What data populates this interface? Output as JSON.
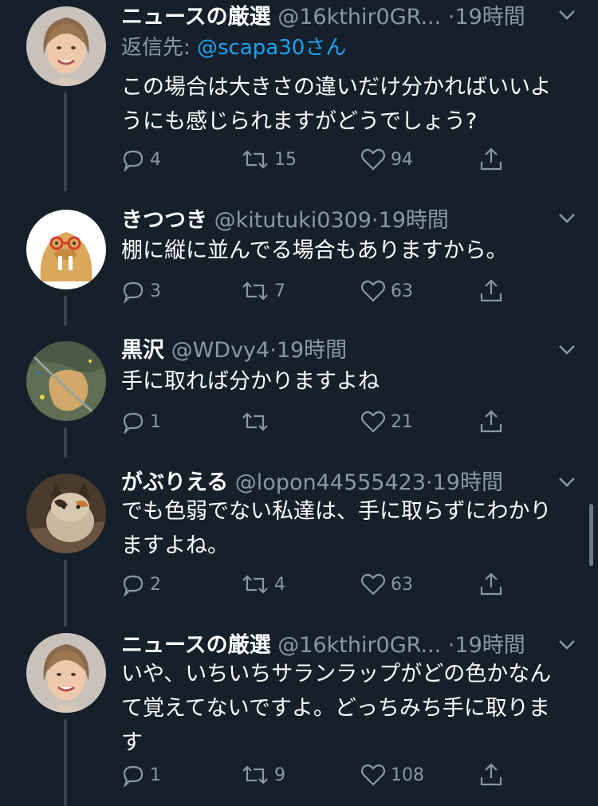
{
  "tweets": [
    {
      "name": "ニュースの厳選",
      "handle": "@16kthir0GR...",
      "time": "19時間",
      "reply_to_label": "返信先:",
      "reply_to_user": "@scapa30さん",
      "text_lines": [
        "この場合は大きさの違いだけ分かればいいよ",
        "うにも感じられますがどうでしょう?"
      ],
      "reply_count": "4",
      "retweet_count": "15",
      "like_count": "94",
      "avatar": "woman-avatar"
    },
    {
      "name": "きつつき",
      "handle": "@kitutuki0309",
      "time": "19時間",
      "text_lines": [
        "棚に縦に並んでる場合もありますから。"
      ],
      "reply_count": "3",
      "retweet_count": "7",
      "like_count": "63",
      "avatar": "walrus-avatar"
    },
    {
      "name": "黒沢",
      "handle": "@WDvy4",
      "time": "19時間",
      "text_lines": [
        "手に取れば分かりますよね"
      ],
      "reply_count": "1",
      "retweet_count": "",
      "like_count": "21",
      "avatar": "map-avatar"
    },
    {
      "name": "がぶりえる",
      "handle": "@lopon44555423",
      "time": "19時間",
      "text_lines": [
        "でも色弱でない私達は、手に取らずにわかり",
        "ますよね。"
      ],
      "reply_count": "2",
      "retweet_count": "4",
      "like_count": "63",
      "avatar": "cat-avatar"
    },
    {
      "name": "ニュースの厳選",
      "handle": "@16kthir0GR...",
      "time": "19時間",
      "text_lines": [
        "いや、いちいちサランラップがどの色かなん",
        "て覚えてないですよ。どっちみち手に取りま",
        "す"
      ],
      "reply_count": "1",
      "retweet_count": "9",
      "like_count": "108",
      "avatar": "woman-avatar"
    }
  ],
  "dot": "·",
  "colors": {
    "background": "#15202b",
    "secondary_text": "#8899a6",
    "link": "#1da1f2",
    "thread_line": "#38444d"
  }
}
